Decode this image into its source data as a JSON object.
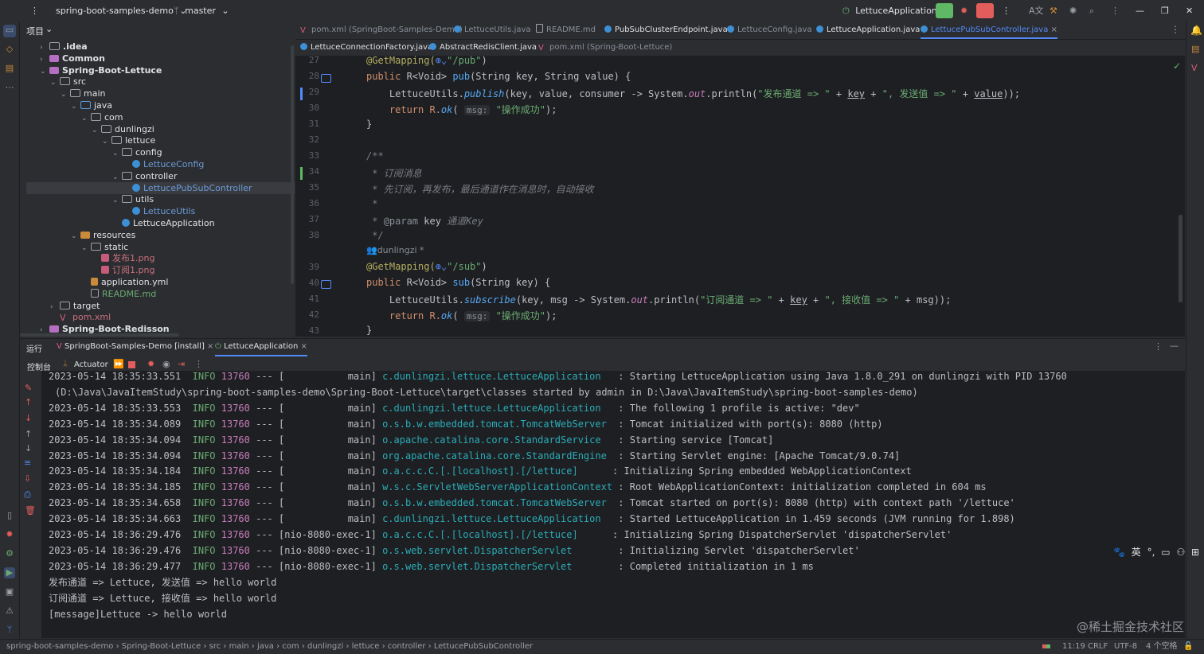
{
  "titlebar": {
    "project": "spring-boot-samples-demo",
    "branch": "master",
    "run_config": "LettuceApplication"
  },
  "project_panel": {
    "title": "项目",
    "tree": [
      {
        "label": ".idea",
        "depth": 1,
        "icon": "folder-icon"
      },
      {
        "label": "Common",
        "depth": 1,
        "icon": "module-icon"
      },
      {
        "label": "Spring-Boot-Lettuce",
        "depth": 1,
        "icon": "module-icon"
      },
      {
        "label": "src",
        "depth": 2,
        "icon": "folder-icon"
      },
      {
        "label": "main",
        "depth": 3,
        "icon": "folder-icon"
      },
      {
        "label": "java",
        "depth": 4,
        "icon": "source-folder-icon"
      },
      {
        "label": "com",
        "depth": 5,
        "icon": "package-icon"
      },
      {
        "label": "dunlingzi",
        "depth": 6,
        "icon": "package-icon"
      },
      {
        "label": "lettuce",
        "depth": 7,
        "icon": "package-icon"
      },
      {
        "label": "config",
        "depth": 8,
        "icon": "package-icon"
      },
      {
        "label": "LettuceConfig",
        "depth": 9,
        "icon": "class-icon"
      },
      {
        "label": "controller",
        "depth": 8,
        "icon": "package-icon"
      },
      {
        "label": "LettucePubSubController",
        "depth": 9,
        "icon": "class-icon"
      },
      {
        "label": "utils",
        "depth": 8,
        "icon": "package-icon"
      },
      {
        "label": "LettuceUtils",
        "depth": 9,
        "icon": "class-icon"
      },
      {
        "label": "LettuceApplication",
        "depth": 8,
        "icon": "spring-class-icon"
      },
      {
        "label": "resources",
        "depth": 4,
        "icon": "resources-folder-icon"
      },
      {
        "label": "static",
        "depth": 5,
        "icon": "folder-icon"
      },
      {
        "label": "发布1.png",
        "depth": 6,
        "icon": "image-icon"
      },
      {
        "label": "订阅1.png",
        "depth": 6,
        "icon": "image-icon"
      },
      {
        "label": "application.yml",
        "depth": 5,
        "icon": "yaml-icon"
      },
      {
        "label": "README.md",
        "depth": 5,
        "icon": "markdown-icon"
      },
      {
        "label": "target",
        "depth": 2,
        "icon": "folder-icon"
      },
      {
        "label": "pom.xml",
        "depth": 2,
        "icon": "maven-icon"
      },
      {
        "label": "Spring-Boot-Redisson",
        "depth": 1,
        "icon": "module-icon"
      }
    ]
  },
  "editor_tabs_row1": [
    {
      "label": "pom.xml (SpringBoot-Samples-Demo)",
      "state": "dim"
    },
    {
      "label": "LettuceUtils.java",
      "state": "dim"
    },
    {
      "label": "README.md",
      "state": "dim"
    },
    {
      "label": "PubSubClusterEndpoint.java",
      "state": "normal"
    },
    {
      "label": "LettuceConfig.java",
      "state": "dim"
    },
    {
      "label": "LettuceApplication.java",
      "state": "normal"
    },
    {
      "label": "LettucePubSubController.java",
      "state": "active"
    }
  ],
  "editor_tabs_row2": [
    {
      "label": "LettuceConnectionFactory.java",
      "state": "normal"
    },
    {
      "label": "AbstractRedisClient.java",
      "state": "normal"
    },
    {
      "label": "pom.xml (Spring-Boot-Lettuce)",
      "state": "dim"
    }
  ],
  "code": {
    "line_numbers": [
      "27",
      "28",
      "29",
      "30",
      "31",
      "32",
      "33",
      "34",
      "35",
      "36",
      "37",
      "38",
      "39",
      "40",
      "41",
      "42",
      "43"
    ],
    "author_hint": "dunlingzi *",
    "lines": {
      "l27_ann": "@GetMapping(",
      "l27_str": "\"/pub\"",
      "l28_a": "public ",
      "l28_b": "R<Void> ",
      "l28_fn": "pub",
      "l28_c": "(String key, String value) {",
      "l29_a": "    LettuceUtils.",
      "l29_fn": "publish",
      "l29_b": "(key, value, consumer -> System.",
      "l29_out": "out",
      "l29_c": ".println(",
      "l29_s1": "\"发布通道 => \"",
      "l29_d": " + ",
      "l29_p1": "key",
      "l29_e": " + ",
      "l29_s2": "\", 发送值 => \"",
      "l29_f": " + ",
      "l29_p2": "value",
      "l29_g": "));",
      "l30_a": "    return R.",
      "l30_fn": "ok",
      "l30_hint": "msg:",
      "l30_str": "\"操作成功\"",
      "l30_end": ");",
      "l31": "}",
      "l33": "/**",
      "l34": " * 订阅消息",
      "l35": " * 先订阅，再发布，最后通道作在消息时，自动接收",
      "l36": " *",
      "l37_a": " * ",
      "l37_tag": "@param",
      "l37_b": " key ",
      "l37_c": "通道Key",
      "l38": " */",
      "l39_ann": "@GetMapping(",
      "l39_str": "\"/sub\"",
      "l40_a": "public ",
      "l40_b": "R<Void> ",
      "l40_fn": "sub",
      "l40_c": "(String key) {",
      "l41_a": "    LettuceUtils.",
      "l41_fn": "subscribe",
      "l41_b": "(key, msg -> System.",
      "l41_out": "out",
      "l41_c": ".println(",
      "l41_s1": "\"订阅通道 => \"",
      "l41_d": " + ",
      "l41_p1": "key",
      "l41_e": " + ",
      "l41_s2": "\", 接收值 => \"",
      "l41_f": " + msg));",
      "l42_a": "    return R.",
      "l42_fn": "ok",
      "l42_hint": "msg:",
      "l42_str": "\"操作成功\"",
      "l42_end": ");",
      "l43": "}"
    }
  },
  "run_panel": {
    "label": "运行",
    "tabs": [
      {
        "label": "SpringBoot-Samples-Demo [install]",
        "active": false
      },
      {
        "label": "LettuceApplication",
        "active": true
      }
    ],
    "console_tab": "控制台",
    "actuator_tab": "Actuator"
  },
  "console_lines": [
    {
      "ts": "2023-05-14 18:35:33.551",
      "lvl": "INFO",
      "pid": "13760",
      "sep": "--- [",
      "thread": "           main]",
      "logger": "c.dunlingzi.lettuce.LettuceApplication  ",
      "msg": ": Starting LettuceApplication using Java 1.8.0_291 on dunlingzi with PID 13760"
    },
    {
      "ts": "",
      "lvl": "",
      "pid": "",
      "sep": "",
      "thread": "",
      "logger": "",
      "msg": "(D:\\Java\\JavaItemStudy\\spring-boot-samples-demo\\Spring-Boot-Lettuce\\target\\classes started by admin in D:\\Java\\JavaItemStudy\\spring-boot-samples-demo)"
    },
    {
      "ts": "2023-05-14 18:35:33.553",
      "lvl": "INFO",
      "pid": "13760",
      "sep": "--- [",
      "thread": "           main]",
      "logger": "c.dunlingzi.lettuce.LettuceApplication  ",
      "msg": ": The following 1 profile is active: \"dev\""
    },
    {
      "ts": "2023-05-14 18:35:34.089",
      "lvl": "INFO",
      "pid": "13760",
      "sep": "--- [",
      "thread": "           main]",
      "logger": "o.s.b.w.embedded.tomcat.TomcatWebServer ",
      "msg": ": Tomcat initialized with port(s): 8080 (http)"
    },
    {
      "ts": "2023-05-14 18:35:34.094",
      "lvl": "INFO",
      "pid": "13760",
      "sep": "--- [",
      "thread": "           main]",
      "logger": "o.apache.catalina.core.StandardService  ",
      "msg": ": Starting service [Tomcat]"
    },
    {
      "ts": "2023-05-14 18:35:34.094",
      "lvl": "INFO",
      "pid": "13760",
      "sep": "--- [",
      "thread": "           main]",
      "logger": "org.apache.catalina.core.StandardEngine ",
      "msg": ": Starting Servlet engine: [Apache Tomcat/9.0.74]"
    },
    {
      "ts": "2023-05-14 18:35:34.184",
      "lvl": "INFO",
      "pid": "13760",
      "sep": "--- [",
      "thread": "           main]",
      "logger": "o.a.c.c.C.[.[localhost].[/lettuce]     ",
      "msg": ": Initializing Spring embedded WebApplicationContext"
    },
    {
      "ts": "2023-05-14 18:35:34.185",
      "lvl": "INFO",
      "pid": "13760",
      "sep": "--- [",
      "thread": "           main]",
      "logger": "w.s.c.ServletWebServerApplicationContext",
      "msg": ": Root WebApplicationContext: initialization completed in 604 ms"
    },
    {
      "ts": "2023-05-14 18:35:34.658",
      "lvl": "INFO",
      "pid": "13760",
      "sep": "--- [",
      "thread": "           main]",
      "logger": "o.s.b.w.embedded.tomcat.TomcatWebServer ",
      "msg": ": Tomcat started on port(s): 8080 (http) with context path '/lettuce'"
    },
    {
      "ts": "2023-05-14 18:35:34.663",
      "lvl": "INFO",
      "pid": "13760",
      "sep": "--- [",
      "thread": "           main]",
      "logger": "c.dunlingzi.lettuce.LettuceApplication  ",
      "msg": ": Started LettuceApplication in 1.459 seconds (JVM running for 1.898)"
    },
    {
      "ts": "2023-05-14 18:36:29.476",
      "lvl": "INFO",
      "pid": "13760",
      "sep": "--- [",
      "thread": "nio-8080-exec-1]",
      "logger": "o.a.c.c.C.[.[localhost].[/lettuce]     ",
      "msg": ": Initializing Spring DispatcherServlet 'dispatcherServlet'"
    },
    {
      "ts": "2023-05-14 18:36:29.476",
      "lvl": "INFO",
      "pid": "13760",
      "sep": "--- [",
      "thread": "nio-8080-exec-1]",
      "logger": "o.s.web.servlet.DispatcherServlet       ",
      "msg": ": Initializing Servlet 'dispatcherServlet'"
    },
    {
      "ts": "2023-05-14 18:36:29.477",
      "lvl": "INFO",
      "pid": "13760",
      "sep": "--- [",
      "thread": "nio-8080-exec-1]",
      "logger": "o.s.web.servlet.DispatcherServlet       ",
      "msg": ": Completed initialization in 1 ms"
    },
    {
      "ts": "",
      "lvl": "",
      "pid": "",
      "sep": "",
      "thread": "",
      "logger": "",
      "msg": "发布通道 => Lettuce, 发送值 => hello world"
    },
    {
      "ts": "",
      "lvl": "",
      "pid": "",
      "sep": "",
      "thread": "",
      "logger": "",
      "msg": "订阅通道 => Lettuce, 接收值 => hello world"
    },
    {
      "ts": "",
      "lvl": "",
      "pid": "",
      "sep": "",
      "thread": "",
      "logger": "",
      "msg": "[message]Lettuce -> hello world"
    }
  ],
  "statusbar": {
    "breadcrumbs": [
      "spring-boot-samples-demo",
      "Spring-Boot-Lettuce",
      "src",
      "main",
      "java",
      "com",
      "dunlingzi",
      "lettuce",
      "controller",
      "LettucePubSubController"
    ],
    "position": "11:19",
    "line_sep": "CRLF",
    "encoding": "UTF-8",
    "indent": "4 个空格"
  },
  "watermark": "@稀土掘金技术社区",
  "ime_toolbar": "英",
  "colors": {
    "accent": "#548af7",
    "run_green": "#5fb865",
    "stop_red": "#e35d5d"
  }
}
